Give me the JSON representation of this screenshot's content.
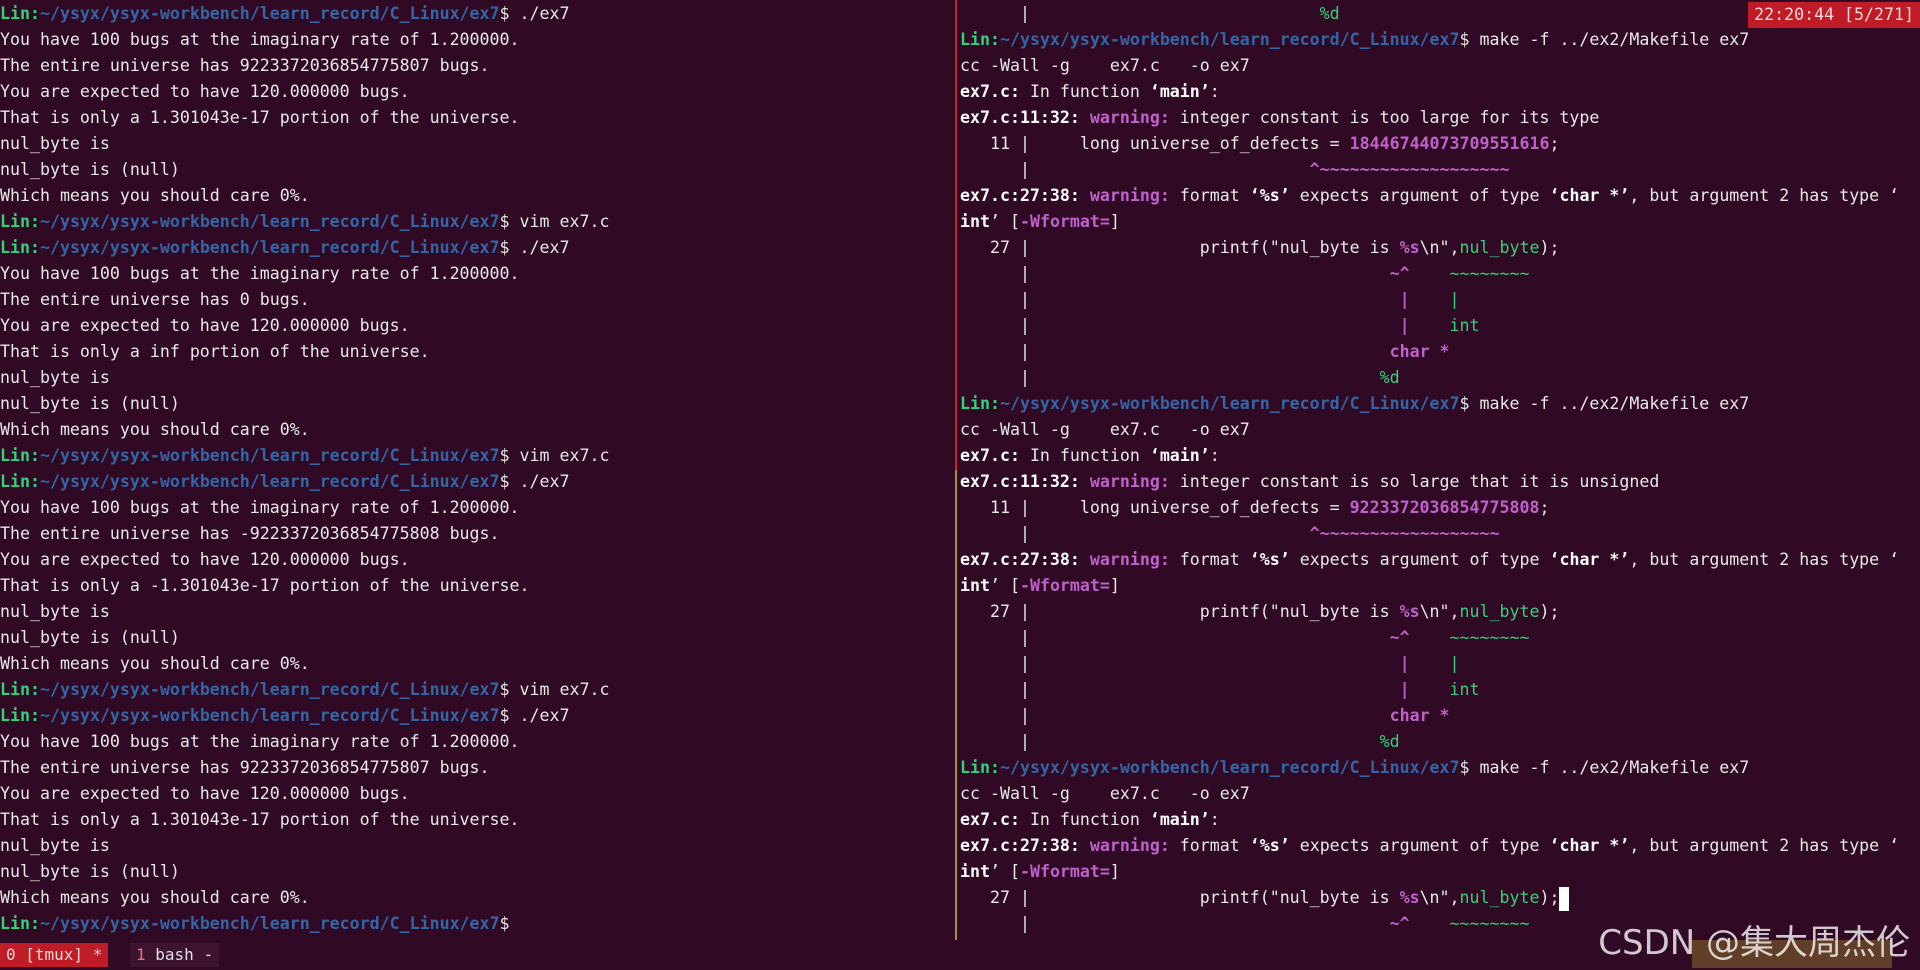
{
  "prompt": {
    "user": "Lin:",
    "path": "~/ysyx/ysyx-workbench/learn_record/C_Linux/ex7",
    "sigil": "$"
  },
  "left_lines": [
    {
      "t": "p",
      "cmd": " ./ex7"
    },
    {
      "t": "o",
      "text": "You have 100 bugs at the imaginary rate of 1.200000."
    },
    {
      "t": "o",
      "text": "The entire universe has 9223372036854775807 bugs."
    },
    {
      "t": "o",
      "text": "You are expected to have 120.000000 bugs."
    },
    {
      "t": "o",
      "text": "That is only a 1.301043e-17 portion of the universe."
    },
    {
      "t": "o",
      "text": "nul_byte is"
    },
    {
      "t": "o",
      "text": "nul_byte is (null)"
    },
    {
      "t": "o",
      "text": "Which means you should care 0%."
    },
    {
      "t": "p",
      "cmd": " vim ex7.c"
    },
    {
      "t": "p",
      "cmd": " ./ex7"
    },
    {
      "t": "o",
      "text": "You have 100 bugs at the imaginary rate of 1.200000."
    },
    {
      "t": "o",
      "text": "The entire universe has 0 bugs."
    },
    {
      "t": "o",
      "text": "You are expected to have 120.000000 bugs."
    },
    {
      "t": "o",
      "text": "That is only a inf portion of the universe."
    },
    {
      "t": "o",
      "text": "nul_byte is"
    },
    {
      "t": "o",
      "text": "nul_byte is (null)"
    },
    {
      "t": "o",
      "text": "Which means you should care 0%."
    },
    {
      "t": "p",
      "cmd": " vim ex7.c"
    },
    {
      "t": "p",
      "cmd": " ./ex7"
    },
    {
      "t": "o",
      "text": "You have 100 bugs at the imaginary rate of 1.200000."
    },
    {
      "t": "o",
      "text": "The entire universe has -9223372036854775808 bugs."
    },
    {
      "t": "o",
      "text": "You are expected to have 120.000000 bugs."
    },
    {
      "t": "o",
      "text": "That is only a -1.301043e-17 portion of the universe."
    },
    {
      "t": "o",
      "text": "nul_byte is"
    },
    {
      "t": "o",
      "text": "nul_byte is (null)"
    },
    {
      "t": "o",
      "text": "Which means you should care 0%."
    },
    {
      "t": "p",
      "cmd": " vim ex7.c"
    },
    {
      "t": "p",
      "cmd": " ./ex7"
    },
    {
      "t": "o",
      "text": "You have 100 bugs at the imaginary rate of 1.200000."
    },
    {
      "t": "o",
      "text": "The entire universe has 9223372036854775807 bugs."
    },
    {
      "t": "o",
      "text": "You are expected to have 120.000000 bugs."
    },
    {
      "t": "o",
      "text": "That is only a 1.301043e-17 portion of the universe."
    },
    {
      "t": "o",
      "text": "nul_byte is"
    },
    {
      "t": "o",
      "text": "nul_byte is (null)"
    },
    {
      "t": "o",
      "text": "Which means you should care 0%."
    },
    {
      "t": "p",
      "cmd": ""
    }
  ],
  "right_lines": [
    {
      "segs": [
        [
          "",
          "      |"
        ],
        [
          "grn",
          "                             %d"
        ]
      ]
    },
    {
      "prompt": true,
      "cmd": " make -f ../ex2/Makefile ex7"
    },
    {
      "segs": [
        [
          "",
          "cc -Wall -g    ex7.c   -o ex7"
        ]
      ]
    },
    {
      "segs": [
        [
          "bold",
          "ex7.c:"
        ],
        [
          "",
          " In function "
        ],
        [
          "bold",
          "‘main’"
        ],
        [
          "",
          ":"
        ]
      ]
    },
    {
      "segs": [
        [
          "bold",
          "ex7.c:11:32:"
        ],
        [
          "warn",
          " warning:"
        ],
        [
          "",
          " integer constant is too large for its type"
        ]
      ]
    },
    {
      "segs": [
        [
          "",
          "   11 |     long universe_of_defects = "
        ],
        [
          "warn",
          "18446744073709551616"
        ],
        [
          "",
          ";"
        ]
      ]
    },
    {
      "segs": [
        [
          "",
          "      |                            "
        ],
        [
          "warn",
          "^~~~~~~~~~~~~~~~~~~~"
        ]
      ]
    },
    {
      "segs": [
        [
          "bold",
          "ex7.c:27:38:"
        ],
        [
          "warn",
          " warning:"
        ],
        [
          "",
          " format "
        ],
        [
          "bold",
          "‘%s’"
        ],
        [
          "",
          " expects argument of type "
        ],
        [
          "bold",
          "‘char *’"
        ],
        [
          "",
          ", but argument 2 has type ‘"
        ]
      ]
    },
    {
      "segs": [
        [
          "bold",
          "int"
        ],
        [
          "",
          "’ ["
        ],
        [
          "warn",
          "-Wformat="
        ],
        [
          "",
          "]"
        ]
      ]
    },
    {
      "segs": [
        [
          "",
          "   27 |                 printf(\"nul_byte is "
        ],
        [
          "warn",
          "%s"
        ],
        [
          "",
          "\\n\","
        ],
        [
          "grn",
          "nul_byte"
        ],
        [
          "",
          ");"
        ]
      ]
    },
    {
      "segs": [
        [
          "",
          "      |                                    "
        ],
        [
          "warn",
          "~^"
        ],
        [
          "grn",
          "    ~~~~~~~~"
        ]
      ]
    },
    {
      "segs": [
        [
          "",
          "      |                                     "
        ],
        [
          "warn",
          "|"
        ],
        [
          "grn",
          "    |"
        ]
      ]
    },
    {
      "segs": [
        [
          "",
          "      |                                     "
        ],
        [
          "warn",
          "|"
        ],
        [
          "grn",
          "    int"
        ]
      ]
    },
    {
      "segs": [
        [
          "",
          "      |                                    "
        ],
        [
          "warn",
          "char *"
        ]
      ]
    },
    {
      "segs": [
        [
          "",
          "      |"
        ],
        [
          "grn",
          "                                   %d"
        ]
      ]
    },
    {
      "prompt": true,
      "cmd": " make -f ../ex2/Makefile ex7"
    },
    {
      "segs": [
        [
          "",
          "cc -Wall -g    ex7.c   -o ex7"
        ]
      ]
    },
    {
      "segs": [
        [
          "bold",
          "ex7.c:"
        ],
        [
          "",
          " In function "
        ],
        [
          "bold",
          "‘main’"
        ],
        [
          "",
          ":"
        ]
      ]
    },
    {
      "segs": [
        [
          "bold",
          "ex7.c:11:32:"
        ],
        [
          "warn",
          " warning:"
        ],
        [
          "",
          " integer constant is so large that it is unsigned"
        ]
      ]
    },
    {
      "segs": [
        [
          "",
          "   11 |     long universe_of_defects = "
        ],
        [
          "warn",
          "9223372036854775808"
        ],
        [
          "",
          ";"
        ]
      ]
    },
    {
      "segs": [
        [
          "",
          "      |                            "
        ],
        [
          "warn",
          "^~~~~~~~~~~~~~~~~~~"
        ]
      ]
    },
    {
      "segs": [
        [
          "bold",
          "ex7.c:27:38:"
        ],
        [
          "warn",
          " warning:"
        ],
        [
          "",
          " format "
        ],
        [
          "bold",
          "‘%s’"
        ],
        [
          "",
          " expects argument of type "
        ],
        [
          "bold",
          "‘char *’"
        ],
        [
          "",
          ", but argument 2 has type ‘"
        ]
      ]
    },
    {
      "segs": [
        [
          "bold",
          "int"
        ],
        [
          "",
          "’ ["
        ],
        [
          "warn",
          "-Wformat="
        ],
        [
          "",
          "]"
        ]
      ]
    },
    {
      "segs": [
        [
          "",
          "   27 |                 printf(\"nul_byte is "
        ],
        [
          "warn",
          "%s"
        ],
        [
          "",
          "\\n\","
        ],
        [
          "grn",
          "nul_byte"
        ],
        [
          "",
          ");"
        ]
      ]
    },
    {
      "segs": [
        [
          "",
          "      |                                    "
        ],
        [
          "warn",
          "~^"
        ],
        [
          "grn",
          "    ~~~~~~~~"
        ]
      ]
    },
    {
      "segs": [
        [
          "",
          "      |                                     "
        ],
        [
          "warn",
          "|"
        ],
        [
          "grn",
          "    |"
        ]
      ]
    },
    {
      "segs": [
        [
          "",
          "      |                                     "
        ],
        [
          "warn",
          "|"
        ],
        [
          "grn",
          "    int"
        ]
      ]
    },
    {
      "segs": [
        [
          "",
          "      |                                    "
        ],
        [
          "warn",
          "char *"
        ]
      ]
    },
    {
      "segs": [
        [
          "",
          "      |"
        ],
        [
          "grn",
          "                                   %d"
        ]
      ]
    },
    {
      "prompt": true,
      "cmd": " make -f ../ex2/Makefile ex7"
    },
    {
      "segs": [
        [
          "",
          "cc -Wall -g    ex7.c   -o ex7"
        ]
      ]
    },
    {
      "segs": [
        [
          "bold",
          "ex7.c:"
        ],
        [
          "",
          " In function "
        ],
        [
          "bold",
          "‘main’"
        ],
        [
          "",
          ":"
        ]
      ]
    },
    {
      "segs": [
        [
          "bold",
          "ex7.c:27:38:"
        ],
        [
          "warn",
          " warning:"
        ],
        [
          "",
          " format "
        ],
        [
          "bold",
          "‘%s’"
        ],
        [
          "",
          " expects argument of type "
        ],
        [
          "bold",
          "‘char *’"
        ],
        [
          "",
          ", but argument 2 has type ‘"
        ]
      ]
    },
    {
      "segs": [
        [
          "bold",
          "int"
        ],
        [
          "",
          "’ ["
        ],
        [
          "warn",
          "-Wformat="
        ],
        [
          "",
          "]"
        ]
      ]
    },
    {
      "segs": [
        [
          "",
          "   27 |                 printf(\"nul_byte is "
        ],
        [
          "warn",
          "%s"
        ],
        [
          "",
          "\\n\","
        ],
        [
          "grn",
          "nul_byte"
        ],
        [
          "",
          ");"
        ]
      ],
      "cursor": true
    },
    {
      "segs": [
        [
          "",
          "      |                                    "
        ],
        [
          "warn",
          "~^"
        ],
        [
          "grn",
          "    ~~~~~~~~"
        ]
      ]
    }
  ],
  "status": {
    "win0": "0 [tmux] *",
    "win1_index": "1",
    "win1_label": " bash -",
    "clock": "22:20:44 [5/271]"
  },
  "watermark": "CSDN @集大周杰伦",
  "colors": {
    "bg": "#300a24",
    "user": "#33d17a",
    "path": "#3465a4",
    "warning": "#c061cb",
    "status_red": "#c01c28"
  }
}
